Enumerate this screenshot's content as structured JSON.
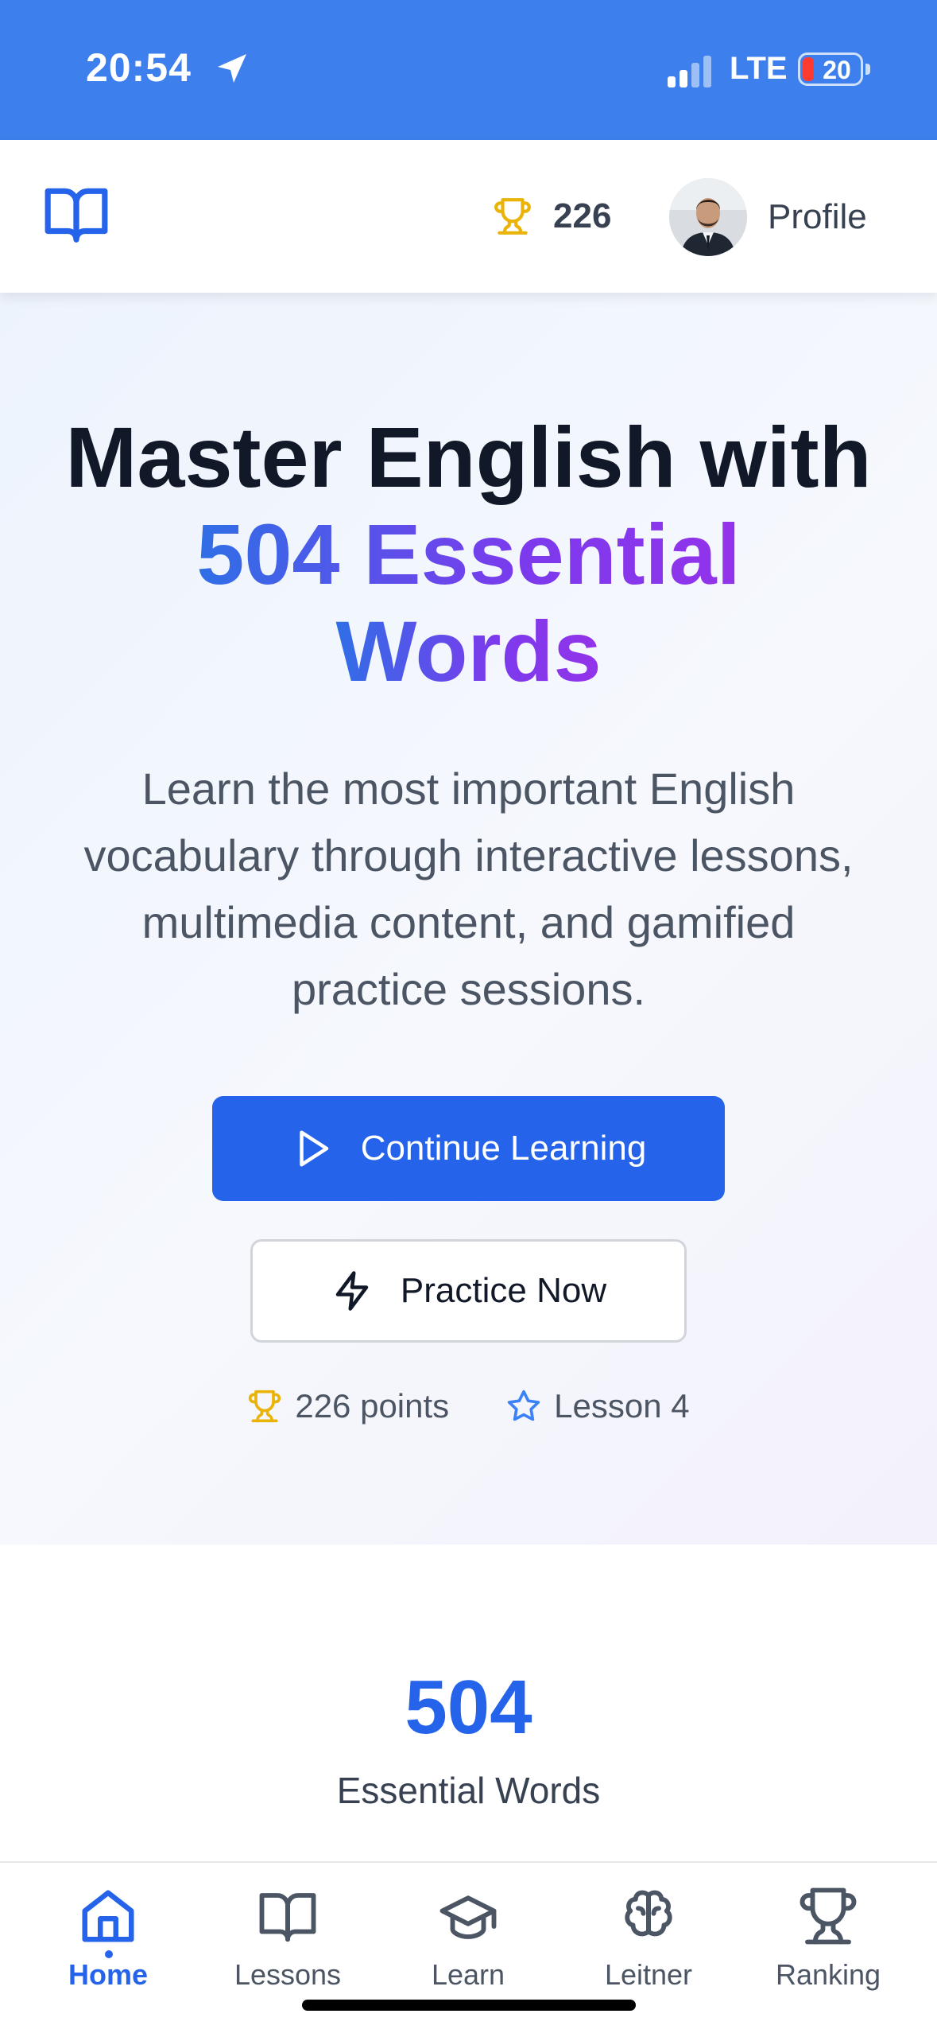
{
  "status_bar": {
    "time": "20:54",
    "network": "LTE",
    "battery": "20",
    "battery_color": "#ff3b30",
    "icons": [
      "location-arrow-icon",
      "signal-icon",
      "battery-icon"
    ]
  },
  "header": {
    "logo_icon": "open-book-icon",
    "score_icon": "trophy-icon",
    "score": "226",
    "profile_label": "Profile",
    "accent_color": "#2563eb"
  },
  "hero": {
    "title_line1": "Master English with",
    "title_accent_line2": "504 Essential",
    "title_accent_line3": "Words",
    "description": "Learn the most important English vocabulary through interactive lessons, multimedia content, and gamified practice sessions.",
    "primary_button": {
      "label": "Continue Learning",
      "icon": "play-icon"
    },
    "secondary_button": {
      "label": "Practice Now",
      "icon": "lightning-icon"
    },
    "stats": [
      {
        "icon": "trophy-icon",
        "label": "226 points"
      },
      {
        "icon": "star-icon",
        "label": "Lesson 4"
      }
    ]
  },
  "count_section": {
    "value": "504",
    "label": "Essential Words"
  },
  "bottom_nav": {
    "active_index": 0,
    "items": [
      {
        "label": "Home",
        "icon": "home-icon"
      },
      {
        "label": "Lessons",
        "icon": "book-icon"
      },
      {
        "label": "Learn",
        "icon": "graduation-cap-icon"
      },
      {
        "label": "Leitner",
        "icon": "brain-icon"
      },
      {
        "label": "Ranking",
        "icon": "trophy-icon"
      }
    ]
  }
}
